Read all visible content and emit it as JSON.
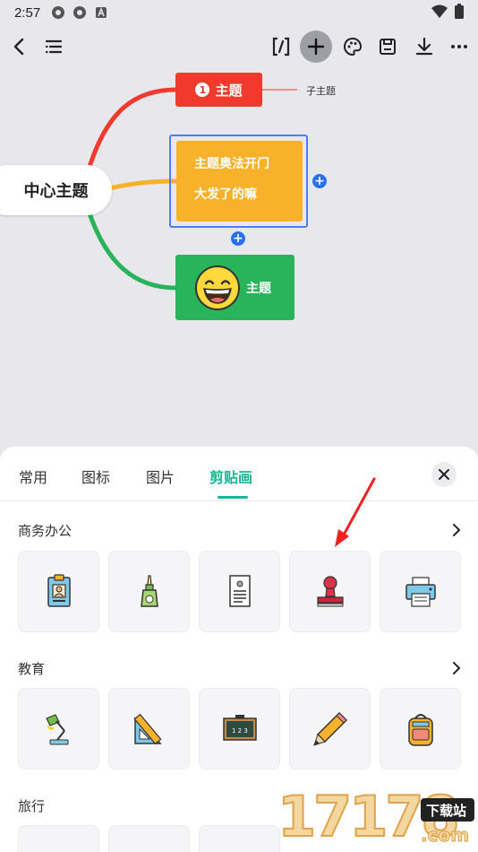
{
  "status_bar": {
    "time": "2:57"
  },
  "mindmap": {
    "central_topic": "中心主题",
    "red_topic": {
      "badge": "1",
      "label": "主题"
    },
    "red_subtopic": "子主题",
    "yellow_topic": {
      "line1": "主题奥法开门",
      "line2": "大发了的嘛"
    },
    "green_topic": "主题",
    "colors": {
      "red": "#f03a2e",
      "yellow": "#f7b12a",
      "green": "#29b35a",
      "selection": "#4a7ff0"
    }
  },
  "panel": {
    "tabs": [
      {
        "label": "常用",
        "active": false
      },
      {
        "label": "图标",
        "active": false
      },
      {
        "label": "图片",
        "active": false
      },
      {
        "label": "剪贴画",
        "active": true
      }
    ],
    "accent": "#14b894",
    "sections": [
      {
        "title": "商务办公",
        "items": [
          "id-badge-clipart",
          "glue-bottle-clipart",
          "document-clipart",
          "stamp-clipart",
          "printer-clipart"
        ]
      },
      {
        "title": "教育",
        "items": [
          "desk-lamp-clipart",
          "ruler-triangle-clipart",
          "blackboard-clipart",
          "pencil-clipart",
          "backpack-clipart"
        ]
      },
      {
        "title": "旅行",
        "items": []
      }
    ]
  },
  "watermark": {
    "text": "17178",
    "badge": "下载站",
    "domain": ".com"
  }
}
